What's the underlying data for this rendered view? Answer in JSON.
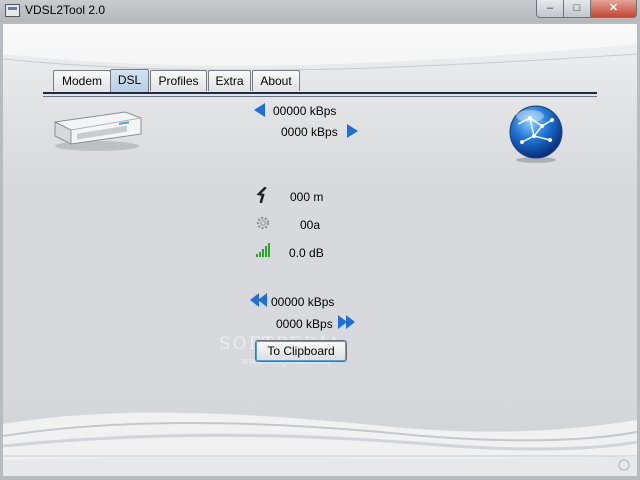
{
  "window": {
    "title": "VDSL2Tool 2.0"
  },
  "tabs": [
    {
      "label": "Modem"
    },
    {
      "label": "DSL"
    },
    {
      "label": "Profiles"
    },
    {
      "label": "Extra"
    },
    {
      "label": "About"
    }
  ],
  "active_tab": "DSL",
  "rates": {
    "upstream_actual": "00000 kBps",
    "downstream_actual": "0000 kBps",
    "upstream_max": "00000 kBps",
    "downstream_max": "0000 kBps"
  },
  "line": {
    "distance": "000 m",
    "profile": "00a",
    "snr": "0.0 dB"
  },
  "buttons": {
    "clipboard": "To Clipboard"
  },
  "watermark": {
    "main": "SOFTPEDIA",
    "sub": "www.softpedia.com"
  },
  "colors": {
    "accent": "#1e6fd6",
    "signal": "#2aa62a",
    "tab_active": "#c3d6ea"
  },
  "icons": [
    "modem-icon",
    "globe-icon",
    "cable-icon",
    "gear-icon",
    "signal-bars-icon",
    "arrow-left-icon",
    "arrow-right-icon",
    "double-arrow-left-icon",
    "double-arrow-right-icon"
  ]
}
